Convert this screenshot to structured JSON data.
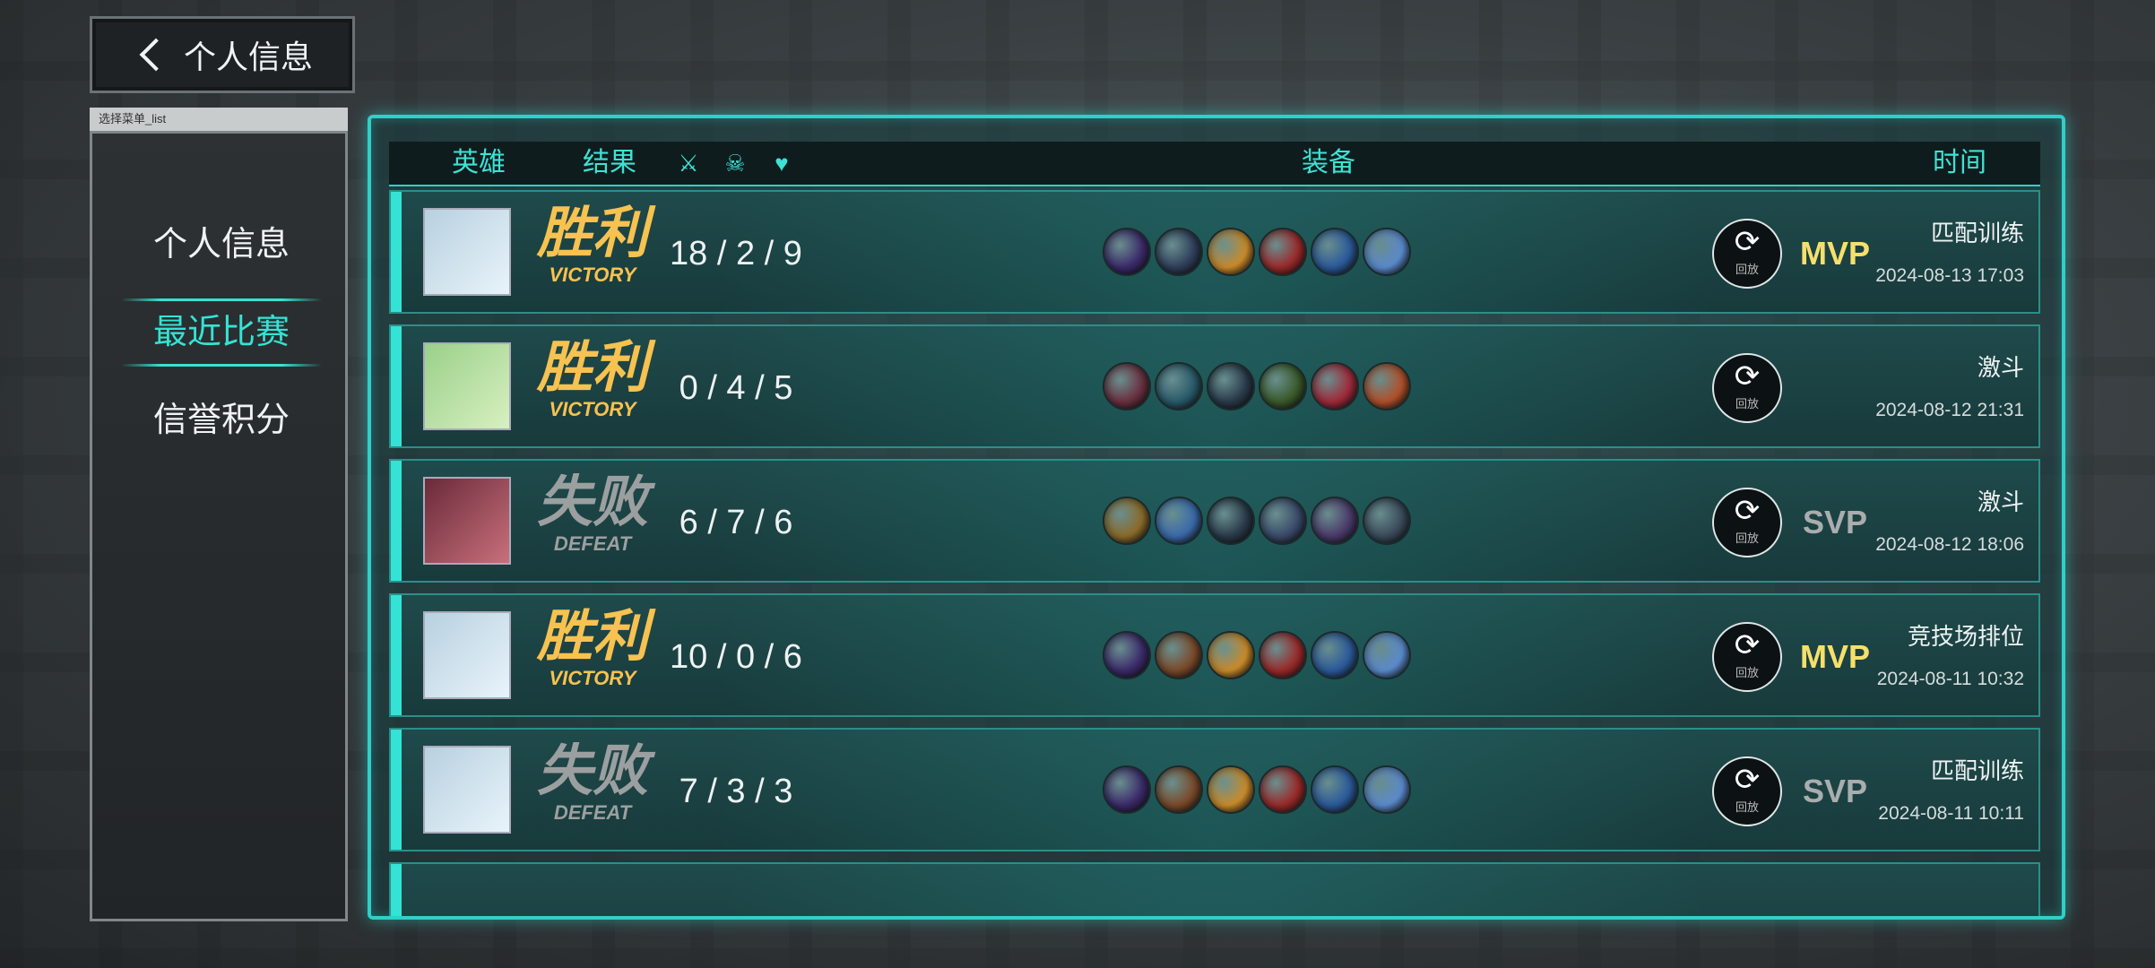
{
  "back": {
    "label": "个人信息"
  },
  "sidebar": {
    "tag": "选择菜单_list",
    "items": [
      {
        "label": "个人信息"
      },
      {
        "label": "最近比赛"
      },
      {
        "label": "信誉积分"
      }
    ]
  },
  "table": {
    "headers": {
      "hero": "英雄",
      "result": "结果",
      "items": "装备",
      "time": "时间"
    },
    "rows": [
      {
        "result_zh": "胜利",
        "result_en": "VICTORY",
        "kda": "18 / 2 / 9",
        "badge": "MVP",
        "mode": "匹配训练",
        "time": "2024-08-13 17:03",
        "replay": "回放",
        "colors": [
          "#3b2a6a",
          "#2f3e5a",
          "#c98a2a",
          "#9a2a2a",
          "#2b5a9a",
          "#5a8acb"
        ]
      },
      {
        "result_zh": "胜利",
        "result_en": "VICTORY",
        "kda": "0 / 4 / 5",
        "badge": "",
        "mode": "激斗",
        "time": "2024-08-12 21:31",
        "replay": "回放",
        "colors": [
          "#6a3040",
          "#2a5a6a",
          "#2a3a4a",
          "#3a5a2a",
          "#a02a3a",
          "#b0502a"
        ]
      },
      {
        "result_zh": "失败",
        "result_en": "DEFEAT",
        "kda": "6 / 7 / 6",
        "badge": "SVP",
        "mode": "激斗",
        "time": "2024-08-12 18:06",
        "replay": "回放",
        "colors": [
          "#8a6a2a",
          "#3a6aaa",
          "#2a3a4a",
          "#3a4a6a",
          "#4a3a6a",
          "#3a4a5a"
        ]
      },
      {
        "result_zh": "胜利",
        "result_en": "VICTORY",
        "kda": "10 / 0 / 6",
        "badge": "MVP",
        "mode": "竞技场排位",
        "time": "2024-08-11 10:32",
        "replay": "回放",
        "colors": [
          "#3b2a6a",
          "#7a4a2a",
          "#c98a2a",
          "#9a2a2a",
          "#2b5a9a",
          "#5a8acb"
        ]
      },
      {
        "result_zh": "失败",
        "result_en": "DEFEAT",
        "kda": "7 / 3 / 3",
        "badge": "SVP",
        "mode": "匹配训练",
        "time": "2024-08-11 10:11",
        "replay": "回放",
        "colors": [
          "#3b2a6a",
          "#7a4a2a",
          "#c98a2a",
          "#9a2a2a",
          "#2b5a9a",
          "#5a8acb"
        ]
      }
    ]
  }
}
